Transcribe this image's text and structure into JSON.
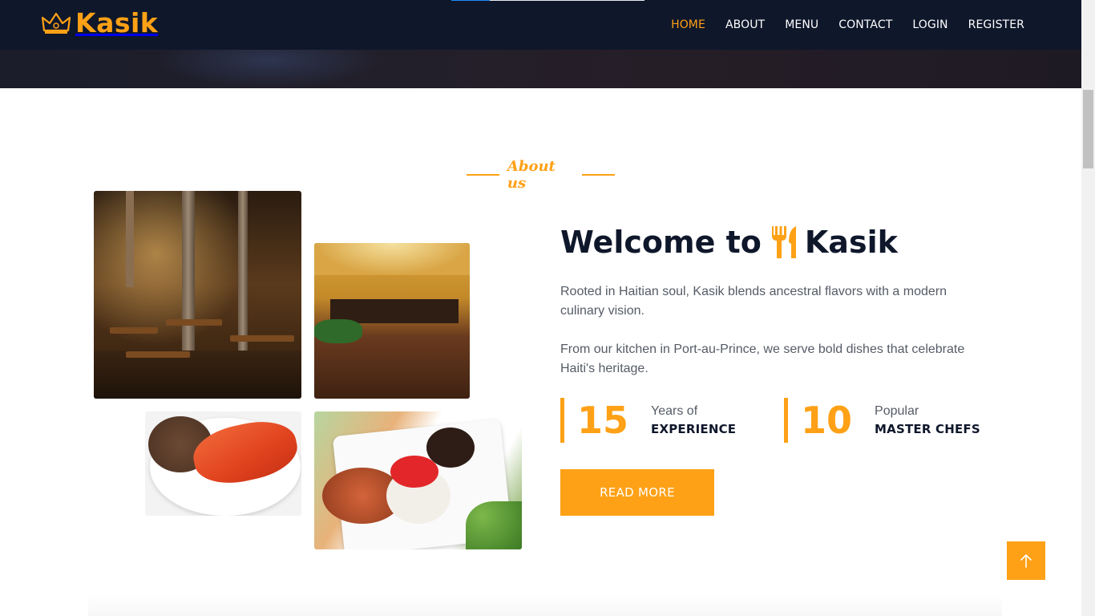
{
  "brand": {
    "name": "Kasik",
    "icon": "crown-icon"
  },
  "nav": {
    "items": [
      {
        "label": "HOME",
        "active": true
      },
      {
        "label": "ABOUT",
        "active": false
      },
      {
        "label": "MENU",
        "active": false
      },
      {
        "label": "CONTACT",
        "active": false
      },
      {
        "label": "LOGIN",
        "active": false
      },
      {
        "label": "REGISTER",
        "active": false
      }
    ]
  },
  "about": {
    "tag": "About us",
    "title_prefix": "Welcome to",
    "title_icon": "utensils-icon",
    "title_suffix": "Kasik",
    "paragraphs": [
      "Rooted in Haitian soul, Kasik blends ancestral flavors with a modern culinary vision.",
      "From our kitchen in Port-au-Prince, we serve bold dishes that celebrate Haiti's heritage."
    ],
    "stats": [
      {
        "number": "15",
        "label_top": "Years of",
        "label_bottom": "EXPERIENCE"
      },
      {
        "number": "10",
        "label_top": "Popular",
        "label_bottom": "MASTER CHEFS"
      }
    ],
    "button": "READ MORE",
    "images": [
      {
        "name": "restaurant-interior-photo"
      },
      {
        "name": "dining-room-photo"
      },
      {
        "name": "fish-dish-photo"
      },
      {
        "name": "crab-plate-photo"
      }
    ]
  },
  "back_to_top": {
    "icon": "arrow-up-icon"
  },
  "colors": {
    "accent": "#fea116",
    "dark": "#0f172b",
    "text": "#555b66"
  }
}
